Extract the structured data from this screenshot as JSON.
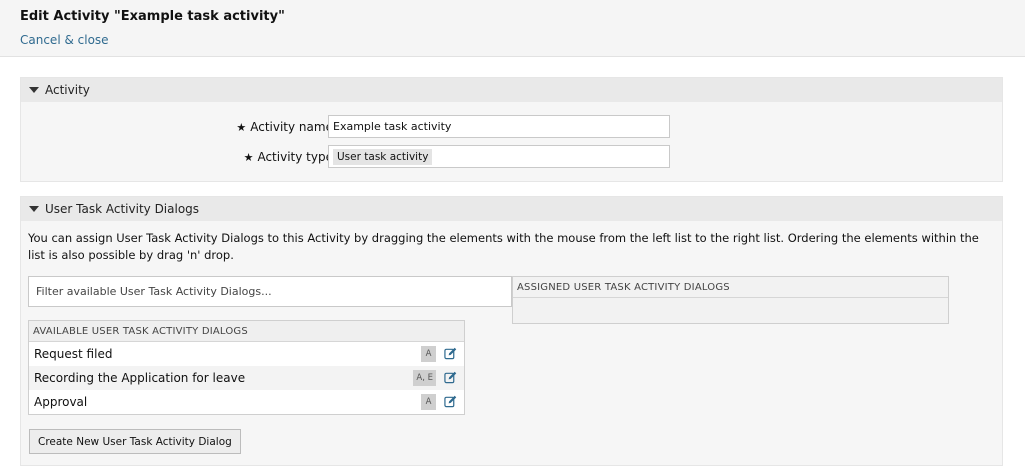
{
  "header": {
    "title": "Edit Activity \"Example task activity\"",
    "cancel_label": "Cancel & close"
  },
  "activity_panel": {
    "title": "Activity",
    "name_label": "Activity name:",
    "name_value": "Example task activity",
    "type_label": "Activity type:",
    "type_value": "User task activity",
    "required_marker": "★"
  },
  "dialogs_panel": {
    "title": "User Task Activity Dialogs",
    "description": "You can assign User Task Activity Dialogs to this Activity by dragging the elements with the mouse from the left list to the right list. Ordering the elements within the list is also possible by drag 'n' drop.",
    "filter_placeholder": "Filter available User Task Activity Dialogs...",
    "assigned_header": "ASSIGNED USER TASK ACTIVITY DIALOGS",
    "available_header": "AVAILABLE USER TASK ACTIVITY DIALOGS",
    "available_items": [
      {
        "label": "Request filed",
        "badge": "A",
        "edit_icon": "edit-icon"
      },
      {
        "label": "Recording the Application for leave",
        "badge": "A, E",
        "edit_icon": "edit-icon"
      },
      {
        "label": "Approval",
        "badge": "A",
        "edit_icon": "edit-icon"
      }
    ],
    "create_button": "Create New User Task Activity Dialog"
  },
  "colors": {
    "link": "#2f6a8f",
    "header_bg": "#f5f5f5",
    "panel_bg": "#f6f6f6",
    "panel_head_bg": "#e9e9e9"
  }
}
